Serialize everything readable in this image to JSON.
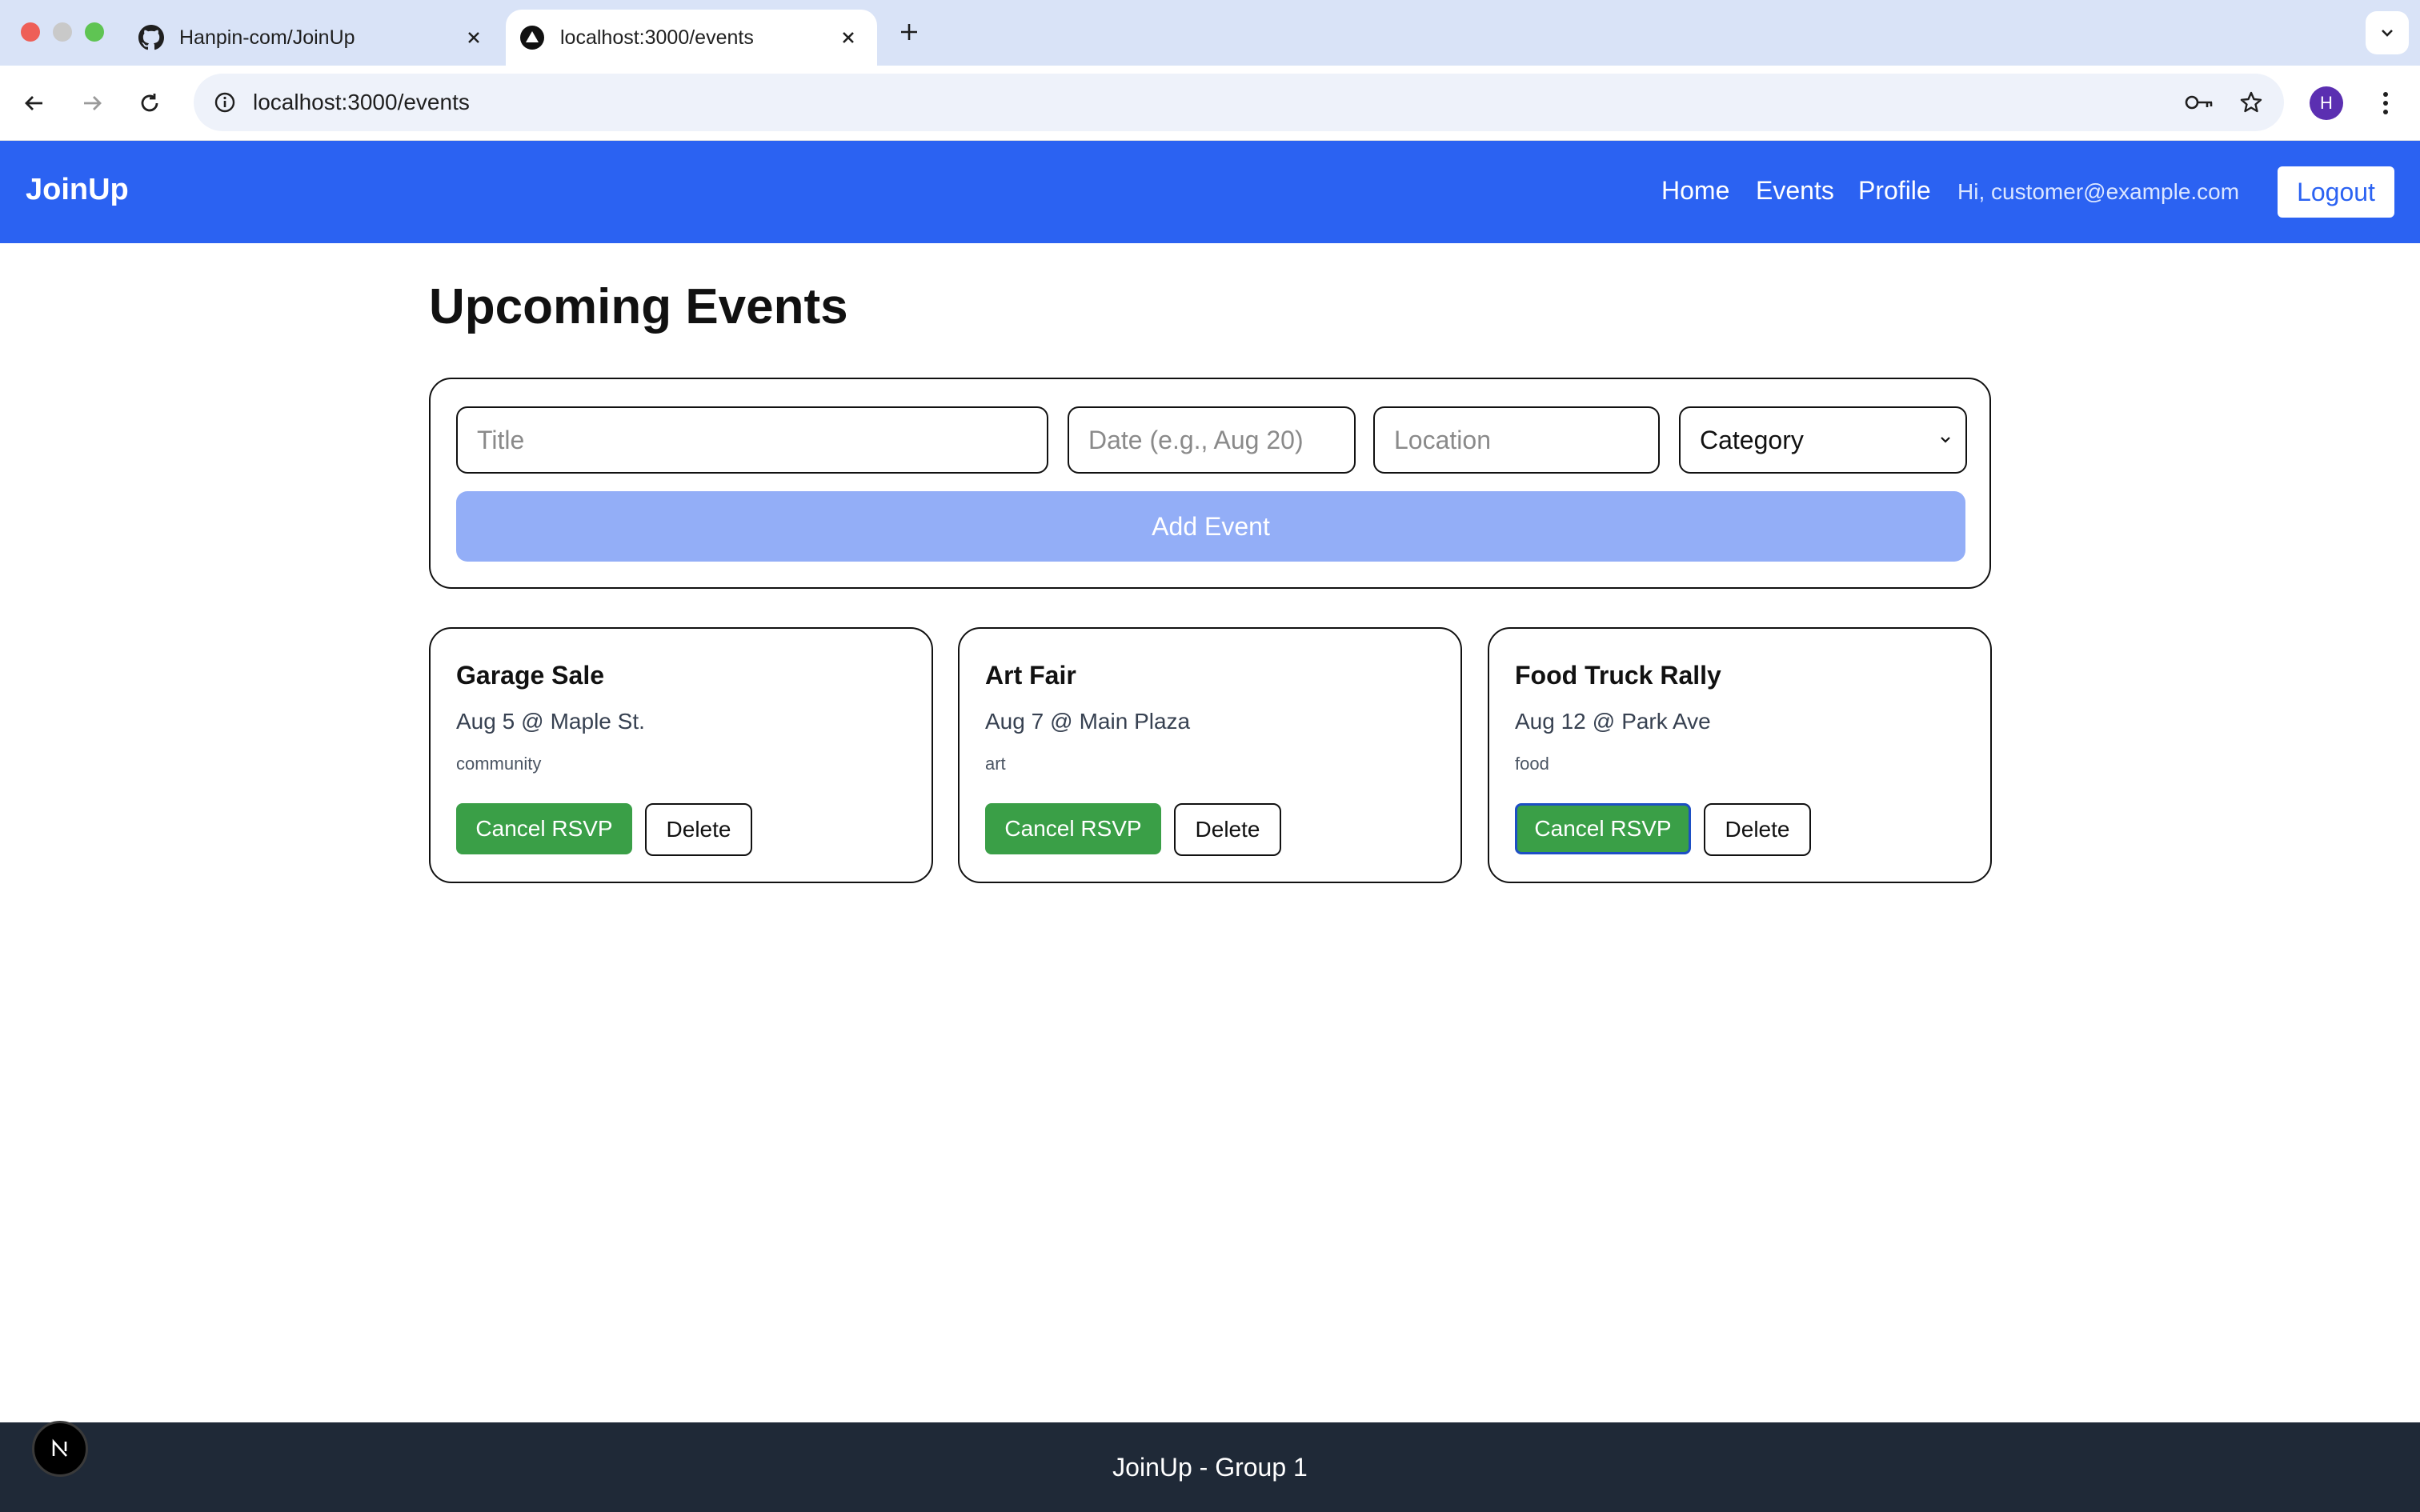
{
  "browser": {
    "tabs": [
      {
        "title": "Hanpin-com/JoinUp",
        "icon": "github-icon"
      },
      {
        "title": "localhost:3000/events",
        "icon": "nextjs-triangle-icon"
      }
    ],
    "url": "localhost:3000/events",
    "profile_initial": "H"
  },
  "header": {
    "brand": "JoinUp",
    "nav": {
      "home": "Home",
      "events": "Events",
      "profile": "Profile"
    },
    "greeting": "Hi, customer@example.com",
    "logout": "Logout",
    "color": "#2b62f2"
  },
  "main": {
    "title": "Upcoming Events",
    "form": {
      "title_placeholder": "Title",
      "date_placeholder": "Date (e.g., Aug 20)",
      "location_placeholder": "Location",
      "category_selected": "Category",
      "add_label": "Add Event"
    },
    "events": [
      {
        "title": "Garage Sale",
        "date": "Aug 5",
        "at": "@",
        "location": "Maple St.",
        "category": "community",
        "rsvp": "Cancel RSVP",
        "delete": "Delete"
      },
      {
        "title": "Art Fair",
        "date": "Aug 7",
        "at": "@",
        "location": "Main Plaza",
        "category": "art",
        "rsvp": "Cancel RSVP",
        "delete": "Delete"
      },
      {
        "title": "Food Truck Rally",
        "date": "Aug 12",
        "at": "@",
        "location": "Park Ave",
        "category": "food",
        "rsvp": "Cancel RSVP",
        "delete": "Delete"
      }
    ]
  },
  "footer": {
    "text": "JoinUp - Group 1",
    "badge": "N"
  },
  "colors": {
    "rsvp_green": "#3a9f47",
    "footer_bg": "#1f2937",
    "add_button": "#93aef7"
  }
}
